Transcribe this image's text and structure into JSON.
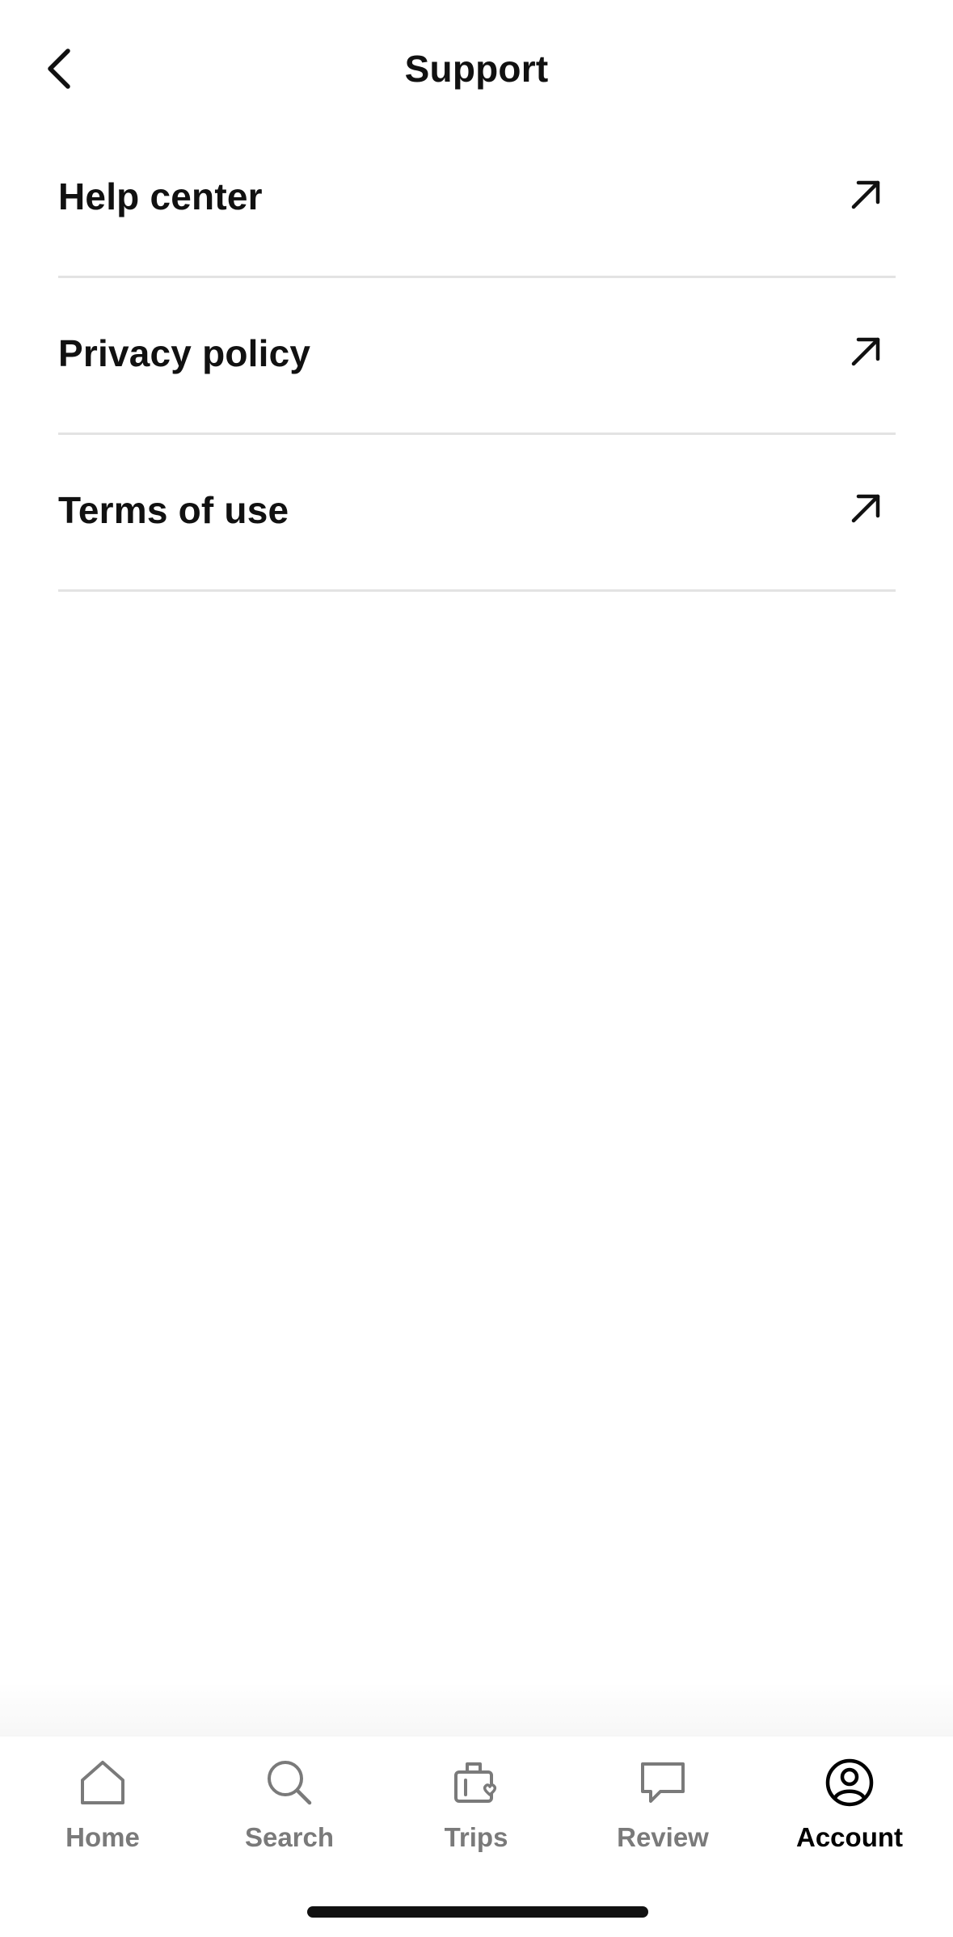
{
  "header": {
    "title": "Support",
    "back_icon": "chevron-left-icon"
  },
  "menu": {
    "items": [
      {
        "label": "Help center",
        "icon": "external-link-arrow-icon"
      },
      {
        "label": "Privacy policy",
        "icon": "external-link-arrow-icon"
      },
      {
        "label": "Terms of use",
        "icon": "external-link-arrow-icon"
      }
    ]
  },
  "tabbar": {
    "active": "Account",
    "tabs": [
      {
        "label": "Home",
        "icon": "home-icon"
      },
      {
        "label": "Search",
        "icon": "search-icon"
      },
      {
        "label": "Trips",
        "icon": "luggage-heart-icon"
      },
      {
        "label": "Review",
        "icon": "chat-bubble-icon"
      },
      {
        "label": "Account",
        "icon": "account-circle-icon"
      }
    ]
  },
  "colors": {
    "text": "#111111",
    "inactive_tab": "#7a7a7a",
    "divider": "#e3e3e3",
    "background": "#ffffff"
  }
}
